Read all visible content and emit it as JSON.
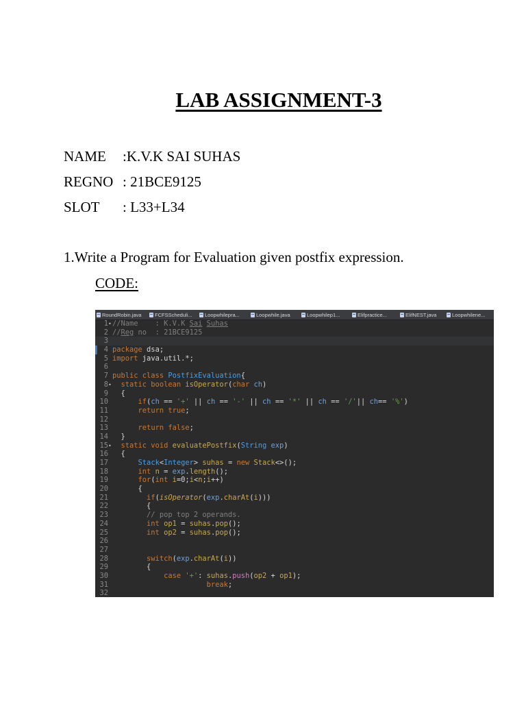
{
  "document": {
    "title": "LAB ASSIGNMENT-3",
    "info": [
      {
        "label": "NAME",
        "value": ":K.V.K SAI SUHAS"
      },
      {
        "label": "REGNO",
        "value": ": 21BCE9125"
      },
      {
        "label": "SLOT",
        "value": ": L33+L34"
      }
    ],
    "question": "1.Write a Program for Evaluation given postfix expression.",
    "code_heading": "CODE:"
  },
  "editor": {
    "tabs": [
      {
        "label": "RoundRobin.java",
        "icon": "java-file-icon"
      },
      {
        "label": "FCFSScheduli...",
        "icon": "java-file-icon"
      },
      {
        "label": "Loopwhilepra...",
        "icon": "java-file-icon"
      },
      {
        "label": "Loopwhile.java",
        "icon": "java-file-icon"
      },
      {
        "label": "Loopwhilep1...",
        "icon": "java-file-icon"
      },
      {
        "label": "Elifpractice...",
        "icon": "java-file-icon"
      },
      {
        "label": "ElifNEST.java",
        "icon": "java-file-icon"
      },
      {
        "label": "Loopwhilene...",
        "icon": "java-file-icon"
      }
    ],
    "colors": {
      "background": "#2b2b2b",
      "keyword": "#cc7832",
      "comment": "#7f7f7f",
      "string": "#6a9955",
      "type": "#4e9ee0",
      "method": "#c9a94f"
    },
    "lines": [
      {
        "n": "1",
        "fold": "•",
        "tokens": [
          [
            "cm",
            "//Name    : K.V.K "
          ],
          [
            "cmu",
            "Sai"
          ],
          [
            "cm",
            " "
          ],
          [
            "cmu",
            "Suhas"
          ]
        ]
      },
      {
        "n": "2",
        "tokens": [
          [
            "cm",
            "//"
          ],
          [
            "cmu",
            "Reg"
          ],
          [
            "cm",
            " no  : 21BCE9125"
          ]
        ]
      },
      {
        "n": "3",
        "current": true,
        "tokens": []
      },
      {
        "n": "4",
        "marker": true,
        "tokens": [
          [
            "kw",
            "package"
          ],
          [
            "src",
            " dsa;"
          ]
        ]
      },
      {
        "n": "5",
        "tokens": [
          [
            "kw",
            "import"
          ],
          [
            "src",
            " java.util.*;"
          ]
        ]
      },
      {
        "n": "6",
        "tokens": []
      },
      {
        "n": "7",
        "tokens": [
          [
            "kw",
            "public class"
          ],
          [
            "src",
            " "
          ],
          [
            "type",
            "PostfixEvaluation"
          ],
          [
            "src",
            "{"
          ]
        ]
      },
      {
        "n": "8",
        "fold": "•",
        "tokens": [
          [
            "src",
            "  "
          ],
          [
            "kw",
            "static boolean"
          ],
          [
            "src",
            " "
          ],
          [
            "fn",
            "isOperator"
          ],
          [
            "src",
            "("
          ],
          [
            "kw",
            "char"
          ],
          [
            "src",
            " "
          ],
          [
            "var",
            "ch"
          ],
          [
            "src",
            ")"
          ]
        ]
      },
      {
        "n": "9",
        "tokens": [
          [
            "src",
            "  {"
          ]
        ]
      },
      {
        "n": "10",
        "tokens": [
          [
            "src",
            "      "
          ],
          [
            "kw",
            "if"
          ],
          [
            "src",
            "("
          ],
          [
            "var",
            "ch"
          ],
          [
            "src",
            " == "
          ],
          [
            "str",
            "'+'"
          ],
          [
            "src",
            " || "
          ],
          [
            "var",
            "ch"
          ],
          [
            "src",
            " == "
          ],
          [
            "str",
            "'-'"
          ],
          [
            "src",
            " || "
          ],
          [
            "var",
            "ch"
          ],
          [
            "src",
            " == "
          ],
          [
            "str",
            "'*'"
          ],
          [
            "src",
            " || "
          ],
          [
            "var",
            "ch"
          ],
          [
            "src",
            " == "
          ],
          [
            "str",
            "'/'"
          ],
          [
            "src",
            "|| "
          ],
          [
            "var",
            "ch"
          ],
          [
            "src",
            "== "
          ],
          [
            "str",
            "'%'"
          ],
          [
            "src",
            ")"
          ]
        ]
      },
      {
        "n": "11",
        "tokens": [
          [
            "src",
            "      "
          ],
          [
            "kw",
            "return true"
          ],
          [
            "src",
            ";"
          ]
        ]
      },
      {
        "n": "12",
        "tokens": []
      },
      {
        "n": "13",
        "tokens": [
          [
            "src",
            "      "
          ],
          [
            "kw",
            "return false"
          ],
          [
            "src",
            ";"
          ]
        ]
      },
      {
        "n": "14",
        "tokens": [
          [
            "src",
            "  }"
          ]
        ]
      },
      {
        "n": "15",
        "fold": "•",
        "tokens": [
          [
            "src",
            "  "
          ],
          [
            "kw",
            "static void"
          ],
          [
            "src",
            " "
          ],
          [
            "fn",
            "evaluatePostfix"
          ],
          [
            "src",
            "("
          ],
          [
            "type",
            "String"
          ],
          [
            "src",
            " "
          ],
          [
            "var",
            "exp"
          ],
          [
            "src",
            ")"
          ]
        ]
      },
      {
        "n": "16",
        "tokens": [
          [
            "src",
            "  {"
          ]
        ]
      },
      {
        "n": "17",
        "tokens": [
          [
            "src",
            "      "
          ],
          [
            "type",
            "Stack"
          ],
          [
            "src",
            "<"
          ],
          [
            "type",
            "Integer"
          ],
          [
            "src",
            "> "
          ],
          [
            "fn",
            "suhas"
          ],
          [
            "src",
            " = "
          ],
          [
            "kw",
            "new"
          ],
          [
            "src",
            " "
          ],
          [
            "fn",
            "Stack"
          ],
          [
            "src",
            "<>();"
          ]
        ]
      },
      {
        "n": "18",
        "tokens": [
          [
            "src",
            "      "
          ],
          [
            "kw",
            "int"
          ],
          [
            "src",
            " "
          ],
          [
            "fn",
            "n"
          ],
          [
            "src",
            " = "
          ],
          [
            "var",
            "exp"
          ],
          [
            "src",
            "."
          ],
          [
            "fn",
            "length"
          ],
          [
            "src",
            "();"
          ]
        ]
      },
      {
        "n": "19",
        "tokens": [
          [
            "src",
            "      "
          ],
          [
            "kw",
            "for"
          ],
          [
            "src",
            "("
          ],
          [
            "kw",
            "int"
          ],
          [
            "src",
            " "
          ],
          [
            "fn",
            "i"
          ],
          [
            "src",
            "=0;"
          ],
          [
            "fn",
            "i"
          ],
          [
            "src",
            "<"
          ],
          [
            "fn",
            "n"
          ],
          [
            "src",
            ";"
          ],
          [
            "fn",
            "i"
          ],
          [
            "src",
            "++)"
          ]
        ]
      },
      {
        "n": "20",
        "tokens": [
          [
            "src",
            "      {"
          ]
        ]
      },
      {
        "n": "21",
        "tokens": [
          [
            "src",
            "        "
          ],
          [
            "kw",
            "if"
          ],
          [
            "src",
            "("
          ],
          [
            "it",
            "isOperator"
          ],
          [
            "src",
            "("
          ],
          [
            "var",
            "exp"
          ],
          [
            "src",
            "."
          ],
          [
            "fn",
            "charAt"
          ],
          [
            "src",
            "("
          ],
          [
            "fn",
            "i"
          ],
          [
            "src",
            ")))"
          ]
        ]
      },
      {
        "n": "22",
        "tokens": [
          [
            "src",
            "        {"
          ]
        ]
      },
      {
        "n": "23",
        "tokens": [
          [
            "src",
            "        "
          ],
          [
            "cm",
            "// pop top 2 operands."
          ]
        ]
      },
      {
        "n": "24",
        "tokens": [
          [
            "src",
            "        "
          ],
          [
            "kw",
            "int"
          ],
          [
            "src",
            " "
          ],
          [
            "fn",
            "op1"
          ],
          [
            "src",
            " = "
          ],
          [
            "fn",
            "suhas"
          ],
          [
            "src",
            "."
          ],
          [
            "fn",
            "pop"
          ],
          [
            "src",
            "();"
          ]
        ]
      },
      {
        "n": "25",
        "tokens": [
          [
            "src",
            "        "
          ],
          [
            "kw",
            "int"
          ],
          [
            "src",
            " "
          ],
          [
            "fn",
            "op2"
          ],
          [
            "src",
            " = "
          ],
          [
            "fn",
            "suhas"
          ],
          [
            "src",
            "."
          ],
          [
            "fn",
            "pop"
          ],
          [
            "src",
            "();"
          ]
        ]
      },
      {
        "n": "26",
        "tokens": []
      },
      {
        "n": "27",
        "tokens": []
      },
      {
        "n": "28",
        "tokens": [
          [
            "src",
            "        "
          ],
          [
            "kw",
            "switch"
          ],
          [
            "src",
            "("
          ],
          [
            "var",
            "exp"
          ],
          [
            "src",
            "."
          ],
          [
            "fn",
            "charAt"
          ],
          [
            "src",
            "("
          ],
          [
            "fn",
            "i"
          ],
          [
            "src",
            "))"
          ]
        ]
      },
      {
        "n": "29",
        "tokens": [
          [
            "src",
            "        {"
          ]
        ]
      },
      {
        "n": "30",
        "tokens": [
          [
            "src",
            "            "
          ],
          [
            "kw",
            "case"
          ],
          [
            "src",
            " "
          ],
          [
            "str",
            "'+'"
          ],
          [
            "src",
            ": "
          ],
          [
            "fn",
            "suhas"
          ],
          [
            "src",
            "."
          ],
          [
            "fld",
            "push"
          ],
          [
            "src",
            "("
          ],
          [
            "fn",
            "op2"
          ],
          [
            "src",
            " + "
          ],
          [
            "fn",
            "op1"
          ],
          [
            "src",
            ");"
          ]
        ]
      },
      {
        "n": "31",
        "tokens": [
          [
            "src",
            "                      "
          ],
          [
            "kw",
            "break"
          ],
          [
            "src",
            ";"
          ]
        ]
      },
      {
        "n": "32",
        "tokens": []
      }
    ]
  }
}
